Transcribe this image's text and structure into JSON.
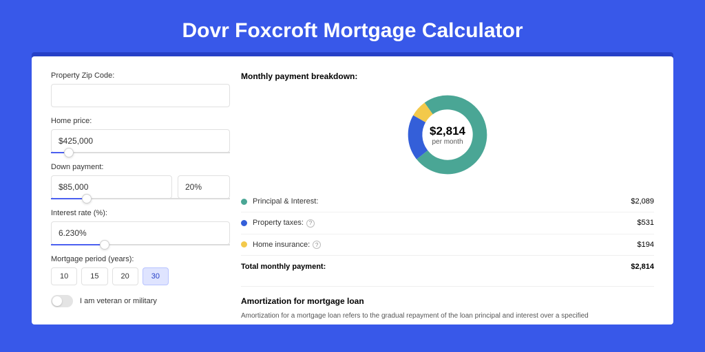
{
  "title": "Dovr Foxcroft Mortgage Calculator",
  "form": {
    "zip_label": "Property Zip Code:",
    "zip_value": "",
    "home_price_label": "Home price:",
    "home_price_value": "$425,000",
    "home_price_slider_pct": 10,
    "down_payment_label": "Down payment:",
    "down_payment_value": "$85,000",
    "down_payment_pct_value": "20%",
    "down_payment_slider_pct": 20,
    "interest_label": "Interest rate (%):",
    "interest_value": "6.230%",
    "interest_slider_pct": 30,
    "period_label": "Mortgage period (years):",
    "periods": [
      "10",
      "15",
      "20",
      "30"
    ],
    "period_active": 3,
    "veteran_label": "I am veteran or military"
  },
  "breakdown": {
    "title": "Monthly payment breakdown:",
    "center_value": "$2,814",
    "center_sub": "per month",
    "items": [
      {
        "color": "#4aa695",
        "label": "Principal & Interest:",
        "value": "$2,089",
        "has_info": false
      },
      {
        "color": "#345fd9",
        "label": "Property taxes:",
        "value": "$531",
        "has_info": true
      },
      {
        "color": "#f3c94b",
        "label": "Home insurance:",
        "value": "$194",
        "has_info": true
      }
    ],
    "total_label": "Total monthly payment:",
    "total_value": "$2,814"
  },
  "chart_data": {
    "type": "pie",
    "title": "Monthly payment breakdown",
    "series": [
      {
        "name": "Principal & Interest",
        "value": 2089,
        "color": "#4aa695"
      },
      {
        "name": "Property taxes",
        "value": 531,
        "color": "#345fd9"
      },
      {
        "name": "Home insurance",
        "value": 194,
        "color": "#f3c94b"
      }
    ],
    "total": 2814
  },
  "amortization": {
    "title": "Amortization for mortgage loan",
    "text": "Amortization for a mortgage loan refers to the gradual repayment of the loan principal and interest over a specified"
  }
}
